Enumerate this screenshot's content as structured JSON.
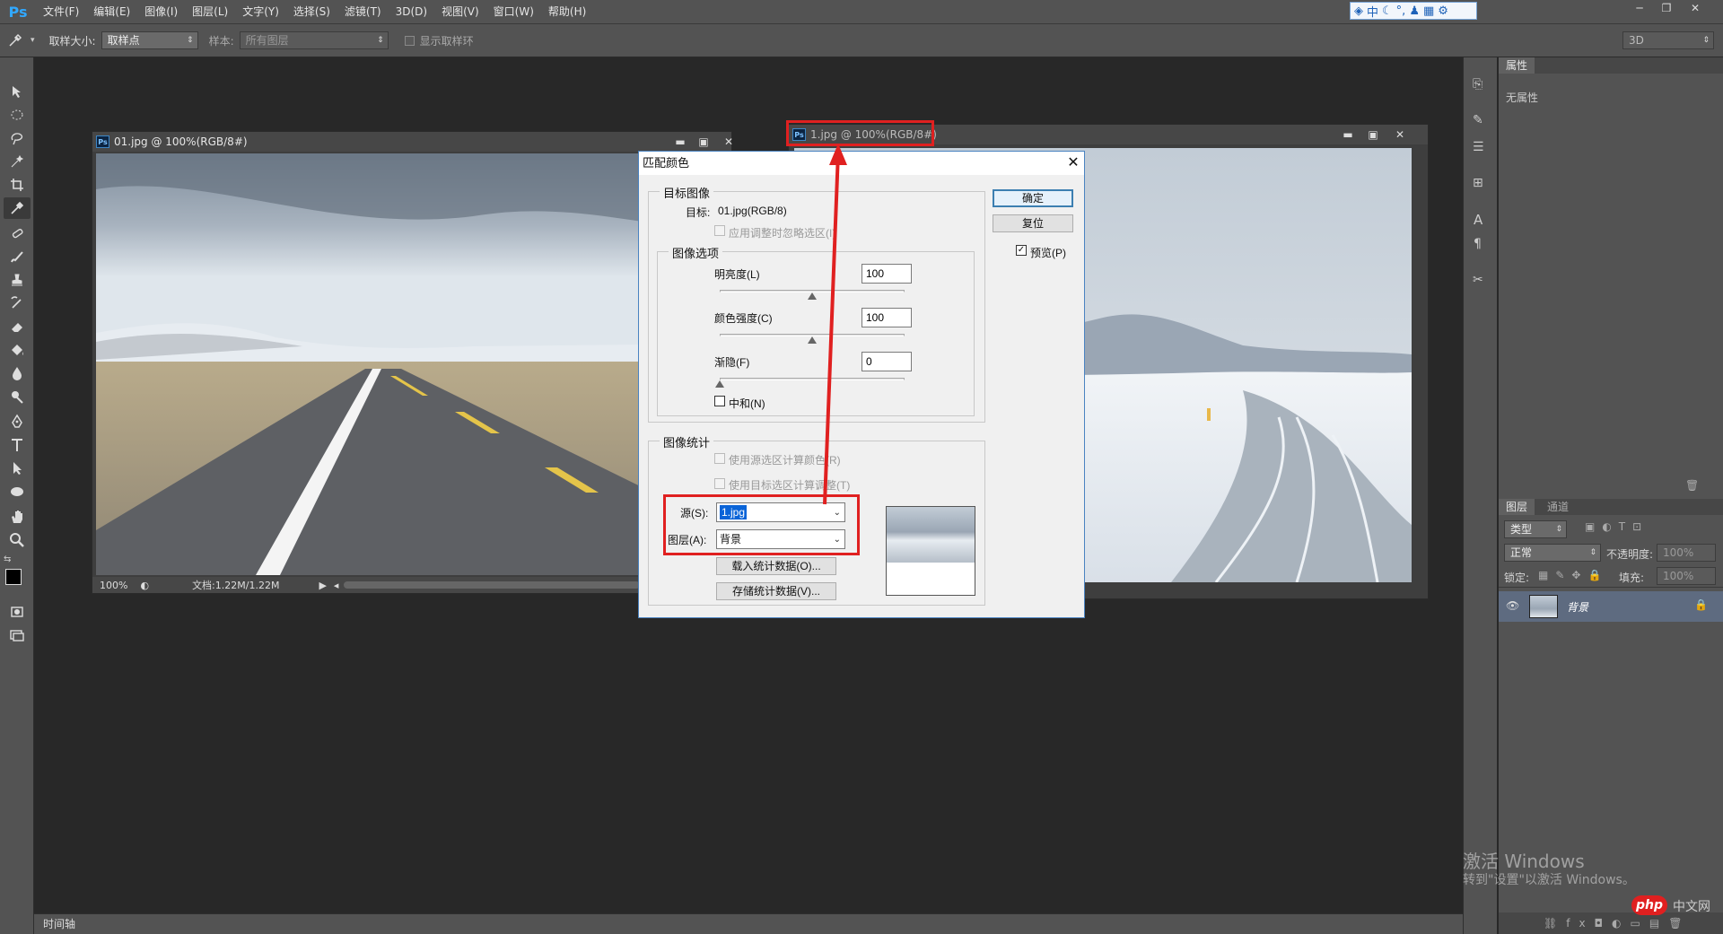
{
  "app": {
    "logo": "Ps"
  },
  "menu": [
    "文件(F)",
    "编辑(E)",
    "图像(I)",
    "图层(L)",
    "文字(Y)",
    "选择(S)",
    "滤镜(T)",
    "3D(D)",
    "视图(V)",
    "窗口(W)",
    "帮助(H)"
  ],
  "ime": {
    "text": "中"
  },
  "options": {
    "sample_size_label": "取样大小:",
    "sample_size_value": "取样点",
    "sample_label": "样本:",
    "sample_value": "所有图层",
    "show_ring_label": "显示取样环",
    "workspace": "3D"
  },
  "doc1": {
    "title": "01.jpg @ 100%(RGB/8#)",
    "zoom": "100%",
    "doc_info": "文档:1.22M/1.22M"
  },
  "doc2": {
    "title": "1.jpg @ 100%(RGB/8#)"
  },
  "properties": {
    "tab": "属性",
    "empty_text": "无属性"
  },
  "layers": {
    "tab_layers": "图层",
    "tab_channels": "通道",
    "filter_kind": "类型",
    "blend_mode": "正常",
    "opacity_label": "不透明度:",
    "opacity_value": "100%",
    "lock_label": "锁定:",
    "fill_label": "填充:",
    "fill_value": "100%",
    "layer_name": "背景"
  },
  "timeline": {
    "label": "时间轴"
  },
  "dialog": {
    "title": "匹配颜色",
    "target_group": "目标图像",
    "target_label": "目标:",
    "target_value": "01.jpg(RGB/8)",
    "ignore_selection": "应用调整时忽略选区(I)",
    "options_group": "图像选项",
    "luminance_label": "明亮度(L)",
    "luminance_value": "100",
    "luminance_level": 100,
    "color_intensity_label": "颜色强度(C)",
    "color_intensity_value": "100",
    "color_intensity_level": 100,
    "fade_label": "渐隐(F)",
    "fade_value": "0",
    "fade_level": 0,
    "neutralize": "中和(N)",
    "stats_group": "图像统计",
    "use_source_sel": "使用源选区计算颜色(R)",
    "use_target_sel": "使用目标选区计算调整(T)",
    "source_label": "源(S):",
    "source_value": "1.jpg",
    "layer_label": "图层(A):",
    "layer_value": "背景",
    "load_stats": "载入统计数据(O)...",
    "save_stats": "存储统计数据(V)...",
    "ok": "确定",
    "reset": "复位",
    "preview": "预览(P)"
  },
  "watermark": {
    "line1": "激活 Windows",
    "line2": "转到\"设置\"以激活 Windows。",
    "site": "php",
    "site_cn": "中文网"
  },
  "colors": {
    "accent": "#e02020",
    "selection": "#0a64d8",
    "ui_dark": "#535353",
    "canvas": "#282828"
  }
}
